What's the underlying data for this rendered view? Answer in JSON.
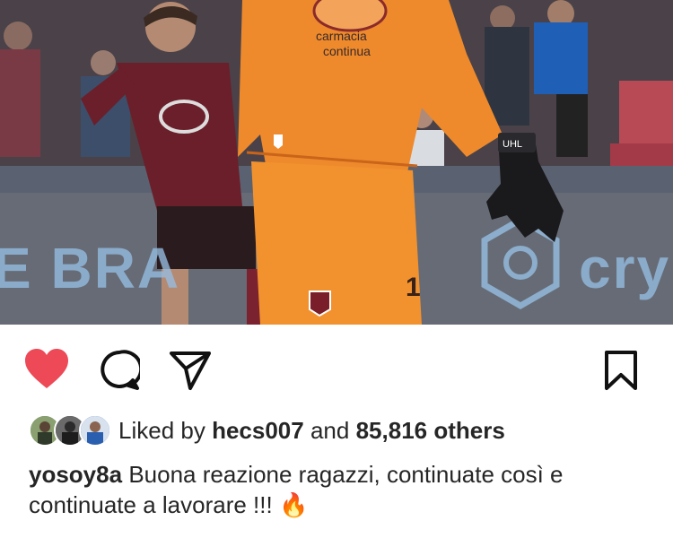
{
  "post": {
    "photo": {
      "description_icon": "photo",
      "board_left": "E BRA",
      "board_right": "cry"
    },
    "actions": {
      "like_icon": "heart-filled-icon",
      "comment_icon": "comment-icon",
      "share_icon": "paper-plane-icon",
      "save_icon": "bookmark-icon",
      "like_color": "#ed4956"
    },
    "likes": {
      "prefix": "Liked by",
      "user": "hecs007",
      "and": "and",
      "count": "85,816 others"
    },
    "caption": {
      "username": "yosoy8a",
      "text": "Buona reazione ragazzi, continuate così e continuate a lavorare !!!",
      "emoji": "🔥"
    }
  }
}
